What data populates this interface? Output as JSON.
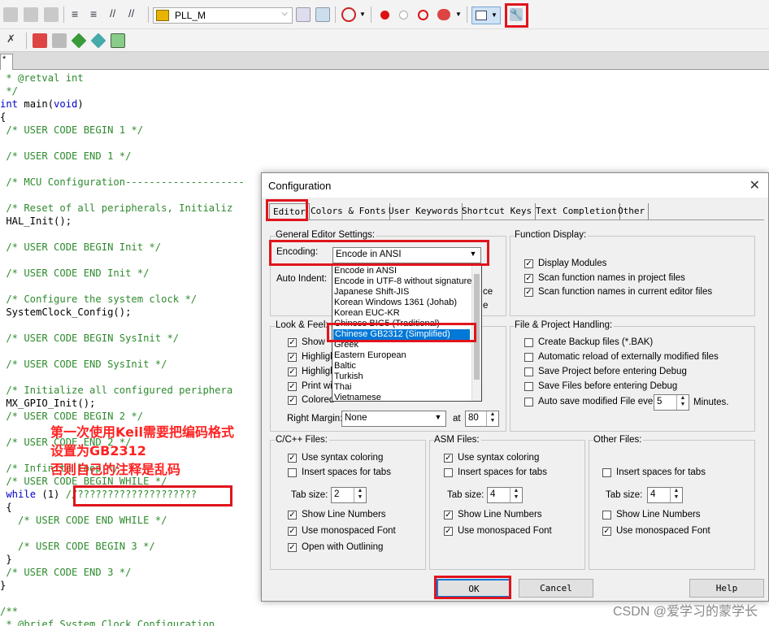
{
  "toolbar": {
    "target_name": "PLL_M",
    "icons": [
      "translate-icon",
      "build-icon",
      "rebuild-icon",
      "indent-icon",
      "unindent-icon",
      "comment-icon",
      "uncomment-icon",
      "open-file-icon",
      "target-options-icon",
      "manage-project-icon",
      "debug-icon",
      "breakpoint-icon",
      "disable-breakpoint-icon",
      "kill-breakpoints-icon",
      "clear-breakpoints-icon",
      "window-layout-icon",
      "configuration-wrench-icon"
    ]
  },
  "file_tab": {
    "label": "*"
  },
  "editor": {
    "lines": [
      {
        "indent": 1,
        "text": " * @retval int",
        "cls": "cm"
      },
      {
        "indent": 1,
        "text": " */",
        "cls": "cm"
      },
      {
        "indent": 0,
        "text": "int main(void)",
        "cls": "kwline"
      },
      {
        "indent": 0,
        "text": "{",
        "cls": ""
      },
      {
        "indent": 1,
        "text": " /* USER CODE BEGIN 1 */",
        "cls": "cm"
      },
      {
        "indent": 0,
        "text": "",
        "cls": ""
      },
      {
        "indent": 1,
        "text": " /* USER CODE END 1 */",
        "cls": "cm"
      },
      {
        "indent": 0,
        "text": "",
        "cls": ""
      },
      {
        "indent": 1,
        "text": " /* MCU Configuration--------------------",
        "cls": "cm"
      },
      {
        "indent": 0,
        "text": "",
        "cls": ""
      },
      {
        "indent": 1,
        "text": " /* Reset of all peripherals, Initializ",
        "cls": "cm"
      },
      {
        "indent": 1,
        "text": " HAL_Init();",
        "cls": ""
      },
      {
        "indent": 0,
        "text": "",
        "cls": ""
      },
      {
        "indent": 1,
        "text": " /* USER CODE BEGIN Init */",
        "cls": "cm"
      },
      {
        "indent": 0,
        "text": "",
        "cls": ""
      },
      {
        "indent": 1,
        "text": " /* USER CODE END Init */",
        "cls": "cm"
      },
      {
        "indent": 0,
        "text": "",
        "cls": ""
      },
      {
        "indent": 1,
        "text": " /* Configure the system clock */",
        "cls": "cm"
      },
      {
        "indent": 1,
        "text": " SystemClock_Config();",
        "cls": ""
      },
      {
        "indent": 0,
        "text": "",
        "cls": ""
      },
      {
        "indent": 1,
        "text": " /* USER CODE BEGIN SysInit */",
        "cls": "cm"
      },
      {
        "indent": 0,
        "text": "",
        "cls": ""
      },
      {
        "indent": 1,
        "text": " /* USER CODE END SysInit */",
        "cls": "cm"
      },
      {
        "indent": 0,
        "text": "",
        "cls": ""
      },
      {
        "indent": 1,
        "text": " /* Initialize all configured periphera",
        "cls": "cm"
      },
      {
        "indent": 1,
        "text": " MX_GPIO_Init();",
        "cls": ""
      },
      {
        "indent": 1,
        "text": " /* USER CODE BEGIN 2 */",
        "cls": "cm"
      },
      {
        "indent": 0,
        "text": "",
        "cls": ""
      },
      {
        "indent": 1,
        "text": " /* USER CODE END 2 */",
        "cls": "cm"
      },
      {
        "indent": 0,
        "text": "",
        "cls": ""
      },
      {
        "indent": 1,
        "text": " /* Infinite loop */",
        "cls": "cm"
      },
      {
        "indent": 1,
        "text": " /* USER CODE BEGIN WHILE */",
        "cls": "cm"
      },
      {
        "indent": 1,
        "text": " while (1) //????????????????????",
        "cls": "while"
      },
      {
        "indent": 1,
        "text": " {",
        "cls": ""
      },
      {
        "indent": 2,
        "text": "   /* USER CODE END WHILE */",
        "cls": "cm"
      },
      {
        "indent": 0,
        "text": "",
        "cls": ""
      },
      {
        "indent": 2,
        "text": "   /* USER CODE BEGIN 3 */",
        "cls": "cm"
      },
      {
        "indent": 1,
        "text": " }",
        "cls": ""
      },
      {
        "indent": 1,
        "text": " /* USER CODE END 3 */",
        "cls": "cm"
      },
      {
        "indent": 0,
        "text": "}",
        "cls": ""
      },
      {
        "indent": 0,
        "text": "",
        "cls": ""
      },
      {
        "indent": 0,
        "text": "/**",
        "cls": "cm"
      },
      {
        "indent": 1,
        "text": " * @brief System Clock Configuration",
        "cls": "cm"
      }
    ]
  },
  "annotation": {
    "line1": "第一次使用Keil需要把编码格式",
    "line2": "设置为GB2312",
    "line3": "否则自己的注释是乱码"
  },
  "dialog": {
    "title": "Configuration",
    "close": "✕",
    "tabs": [
      "Editor",
      "Colors & Fonts",
      "User Keywords",
      "Shortcut Keys",
      "Text Completion",
      "Other"
    ],
    "general": {
      "label": "General Editor Settings:",
      "encoding_label": "Encoding:",
      "encoding_value": "Encode in ANSI",
      "auto_indent_label": "Auto Indent:",
      "partial_1": "ce",
      "partial_2": "e"
    },
    "encoding_options": [
      "Encode in ANSI",
      "Encode in UTF-8 without signature",
      "Japanese Shift-JIS",
      "Korean Windows 1361 (Johab)",
      "Korean EUC-KR",
      "Chinese BIG5 (Traditional)",
      "Chinese GB2312 (Simplified)",
      "Greek",
      "Eastern European",
      "Baltic",
      "Turkish",
      "Thai",
      "Vietnamese"
    ],
    "encoding_selected_index": 6,
    "function_display": {
      "label": "Function Display:",
      "items": [
        {
          "label": "Display Modules",
          "checked": true
        },
        {
          "label": "Scan function names in project files",
          "checked": true
        },
        {
          "label": "Scan function names in current editor files",
          "checked": true
        }
      ]
    },
    "look_feel": {
      "label": "Look & Feel:",
      "items": [
        {
          "label": "Show",
          "checked": true
        },
        {
          "label": "Highligh",
          "checked": true
        },
        {
          "label": "Highligh",
          "checked": true
        },
        {
          "label": "Print wit",
          "checked": true
        },
        {
          "label": "Colored",
          "checked": true
        }
      ],
      "right_margin_label": "Right Margin:",
      "right_margin_value": "None",
      "at_label": "at",
      "at_value": "80"
    },
    "file_project": {
      "label": "File & Project Handling:",
      "items": [
        {
          "label": "Create Backup files (*.BAK)",
          "checked": false
        },
        {
          "label": "Automatic reload of externally modified files",
          "checked": false
        },
        {
          "label": "Save Project before entering Debug",
          "checked": false
        },
        {
          "label": "Save Files before entering Debug",
          "checked": false
        },
        {
          "label": "Auto save modified File every",
          "checked": false
        }
      ],
      "minutes_value": "5",
      "minutes_label": "Minutes."
    },
    "cpp_files": {
      "label": "C/C++ Files:",
      "syntax": {
        "label": "Use syntax coloring",
        "checked": true
      },
      "spaces": {
        "label": "Insert spaces for tabs",
        "checked": false
      },
      "tab_size_label": "Tab size:",
      "tab_size": "2",
      "line_numbers": {
        "label": "Show Line Numbers",
        "checked": true
      },
      "monospaced": {
        "label": "Use monospaced Font",
        "checked": true
      },
      "outlining": {
        "label": "Open with Outlining",
        "checked": true
      }
    },
    "asm_files": {
      "label": "ASM Files:",
      "syntax": {
        "label": "Use syntax coloring",
        "checked": true
      },
      "spaces": {
        "label": "Insert spaces for tabs",
        "checked": false
      },
      "tab_size_label": "Tab size:",
      "tab_size": "4",
      "line_numbers": {
        "label": "Show Line Numbers",
        "checked": true
      },
      "monospaced": {
        "label": "Use monospaced Font",
        "checked": true
      }
    },
    "other_files": {
      "label": "Other Files:",
      "spaces": {
        "label": "Insert spaces for tabs",
        "checked": false
      },
      "tab_size_label": "Tab size:",
      "tab_size": "4",
      "line_numbers": {
        "label": "Show Line Numbers",
        "checked": false
      },
      "monospaced": {
        "label": "Use monospaced Font",
        "checked": true
      }
    },
    "buttons": {
      "ok": "OK",
      "cancel": "Cancel",
      "help": "Help"
    }
  },
  "watermark": "CSDN @爱学习的蒙学长",
  "colors": {
    "highlight_box": "#e0141c",
    "annotation_text": "#ff2222",
    "comment": "#2e8b2e",
    "keyword": "#0000cc",
    "selection": "#0078d7"
  }
}
